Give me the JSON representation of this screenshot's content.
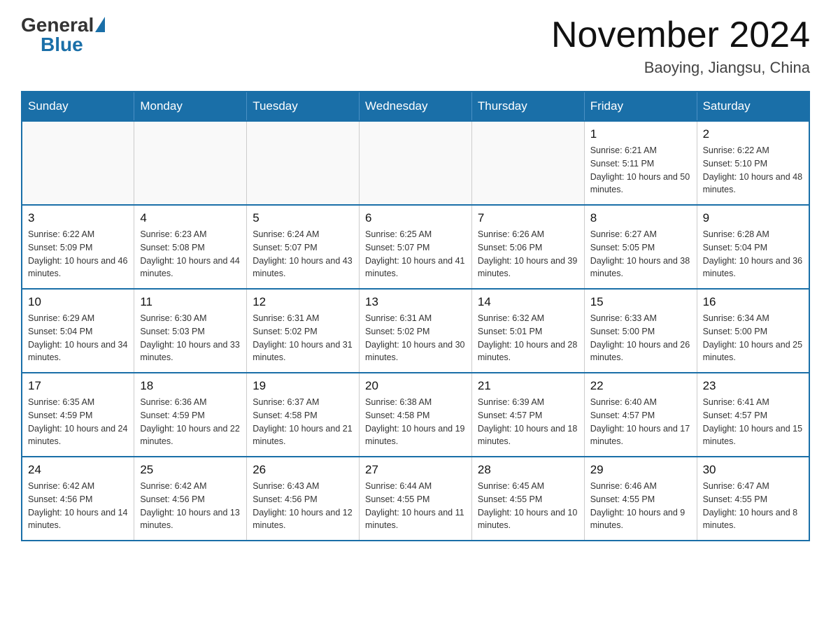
{
  "logo": {
    "general": "General",
    "blue": "Blue"
  },
  "title": "November 2024",
  "location": "Baoying, Jiangsu, China",
  "days_of_week": [
    "Sunday",
    "Monday",
    "Tuesday",
    "Wednesday",
    "Thursday",
    "Friday",
    "Saturday"
  ],
  "weeks": [
    [
      {
        "day": "",
        "info": ""
      },
      {
        "day": "",
        "info": ""
      },
      {
        "day": "",
        "info": ""
      },
      {
        "day": "",
        "info": ""
      },
      {
        "day": "",
        "info": ""
      },
      {
        "day": "1",
        "info": "Sunrise: 6:21 AM\nSunset: 5:11 PM\nDaylight: 10 hours and 50 minutes."
      },
      {
        "day": "2",
        "info": "Sunrise: 6:22 AM\nSunset: 5:10 PM\nDaylight: 10 hours and 48 minutes."
      }
    ],
    [
      {
        "day": "3",
        "info": "Sunrise: 6:22 AM\nSunset: 5:09 PM\nDaylight: 10 hours and 46 minutes."
      },
      {
        "day": "4",
        "info": "Sunrise: 6:23 AM\nSunset: 5:08 PM\nDaylight: 10 hours and 44 minutes."
      },
      {
        "day": "5",
        "info": "Sunrise: 6:24 AM\nSunset: 5:07 PM\nDaylight: 10 hours and 43 minutes."
      },
      {
        "day": "6",
        "info": "Sunrise: 6:25 AM\nSunset: 5:07 PM\nDaylight: 10 hours and 41 minutes."
      },
      {
        "day": "7",
        "info": "Sunrise: 6:26 AM\nSunset: 5:06 PM\nDaylight: 10 hours and 39 minutes."
      },
      {
        "day": "8",
        "info": "Sunrise: 6:27 AM\nSunset: 5:05 PM\nDaylight: 10 hours and 38 minutes."
      },
      {
        "day": "9",
        "info": "Sunrise: 6:28 AM\nSunset: 5:04 PM\nDaylight: 10 hours and 36 minutes."
      }
    ],
    [
      {
        "day": "10",
        "info": "Sunrise: 6:29 AM\nSunset: 5:04 PM\nDaylight: 10 hours and 34 minutes."
      },
      {
        "day": "11",
        "info": "Sunrise: 6:30 AM\nSunset: 5:03 PM\nDaylight: 10 hours and 33 minutes."
      },
      {
        "day": "12",
        "info": "Sunrise: 6:31 AM\nSunset: 5:02 PM\nDaylight: 10 hours and 31 minutes."
      },
      {
        "day": "13",
        "info": "Sunrise: 6:31 AM\nSunset: 5:02 PM\nDaylight: 10 hours and 30 minutes."
      },
      {
        "day": "14",
        "info": "Sunrise: 6:32 AM\nSunset: 5:01 PM\nDaylight: 10 hours and 28 minutes."
      },
      {
        "day": "15",
        "info": "Sunrise: 6:33 AM\nSunset: 5:00 PM\nDaylight: 10 hours and 26 minutes."
      },
      {
        "day": "16",
        "info": "Sunrise: 6:34 AM\nSunset: 5:00 PM\nDaylight: 10 hours and 25 minutes."
      }
    ],
    [
      {
        "day": "17",
        "info": "Sunrise: 6:35 AM\nSunset: 4:59 PM\nDaylight: 10 hours and 24 minutes."
      },
      {
        "day": "18",
        "info": "Sunrise: 6:36 AM\nSunset: 4:59 PM\nDaylight: 10 hours and 22 minutes."
      },
      {
        "day": "19",
        "info": "Sunrise: 6:37 AM\nSunset: 4:58 PM\nDaylight: 10 hours and 21 minutes."
      },
      {
        "day": "20",
        "info": "Sunrise: 6:38 AM\nSunset: 4:58 PM\nDaylight: 10 hours and 19 minutes."
      },
      {
        "day": "21",
        "info": "Sunrise: 6:39 AM\nSunset: 4:57 PM\nDaylight: 10 hours and 18 minutes."
      },
      {
        "day": "22",
        "info": "Sunrise: 6:40 AM\nSunset: 4:57 PM\nDaylight: 10 hours and 17 minutes."
      },
      {
        "day": "23",
        "info": "Sunrise: 6:41 AM\nSunset: 4:57 PM\nDaylight: 10 hours and 15 minutes."
      }
    ],
    [
      {
        "day": "24",
        "info": "Sunrise: 6:42 AM\nSunset: 4:56 PM\nDaylight: 10 hours and 14 minutes."
      },
      {
        "day": "25",
        "info": "Sunrise: 6:42 AM\nSunset: 4:56 PM\nDaylight: 10 hours and 13 minutes."
      },
      {
        "day": "26",
        "info": "Sunrise: 6:43 AM\nSunset: 4:56 PM\nDaylight: 10 hours and 12 minutes."
      },
      {
        "day": "27",
        "info": "Sunrise: 6:44 AM\nSunset: 4:55 PM\nDaylight: 10 hours and 11 minutes."
      },
      {
        "day": "28",
        "info": "Sunrise: 6:45 AM\nSunset: 4:55 PM\nDaylight: 10 hours and 10 minutes."
      },
      {
        "day": "29",
        "info": "Sunrise: 6:46 AM\nSunset: 4:55 PM\nDaylight: 10 hours and 9 minutes."
      },
      {
        "day": "30",
        "info": "Sunrise: 6:47 AM\nSunset: 4:55 PM\nDaylight: 10 hours and 8 minutes."
      }
    ]
  ]
}
